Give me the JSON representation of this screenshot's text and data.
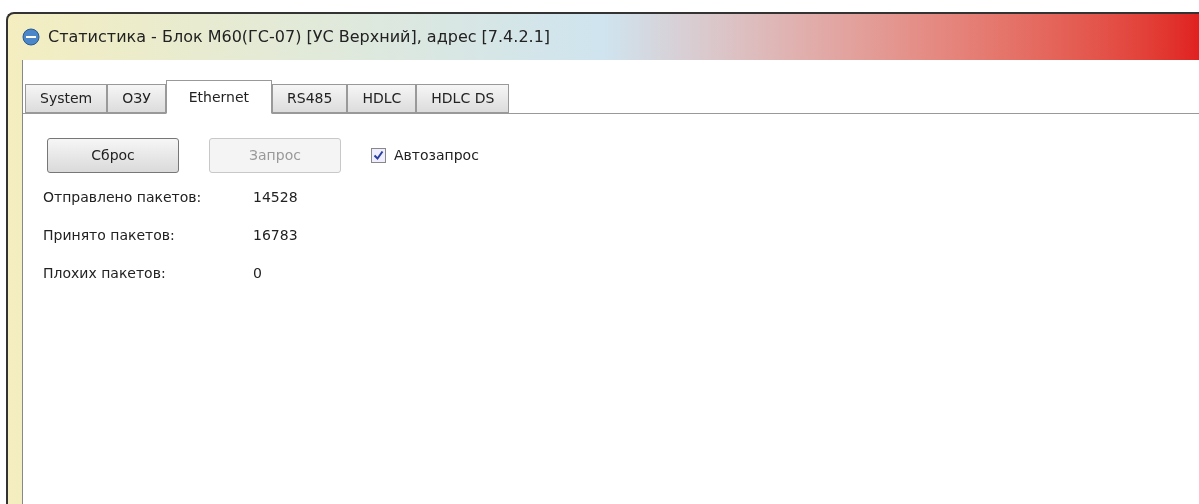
{
  "window": {
    "title": "Статистика - Блок М60(ГС-07) [УС Верхний], адрес [7.4.2.1]"
  },
  "tabs": [
    {
      "label": "System",
      "selected": false
    },
    {
      "label": "ОЗУ",
      "selected": false
    },
    {
      "label": "Ethernet",
      "selected": true
    },
    {
      "label": "RS485",
      "selected": false
    },
    {
      "label": "HDLC",
      "selected": false
    },
    {
      "label": "HDLC DS",
      "selected": false
    }
  ],
  "buttons": [
    {
      "label": "Сброс",
      "disabled": false
    },
    {
      "label": "Запрос",
      "disabled": true
    }
  ],
  "autorequest": {
    "label": "Автозапрос",
    "checked": true
  },
  "stats": [
    {
      "label": "Отправлено пакетов:",
      "value": "14528"
    },
    {
      "label": "Принято пакетов:",
      "value": "16783"
    },
    {
      "label": "Плохих пакетов:",
      "value": "0"
    }
  ]
}
